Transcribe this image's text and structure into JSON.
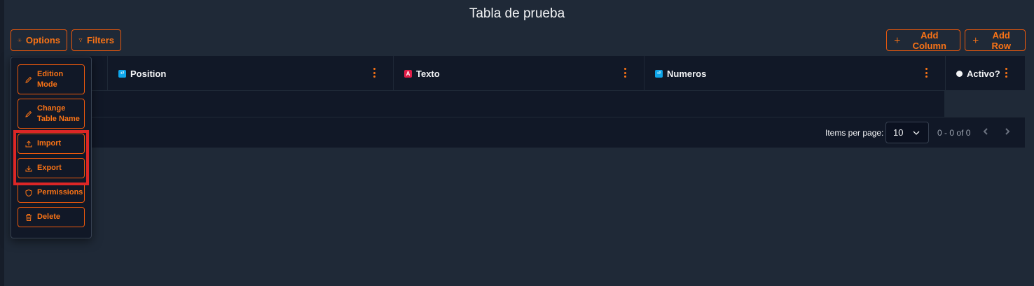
{
  "page": {
    "title": "Tabla de prueba"
  },
  "toolbar": {
    "options_label": "Options",
    "filters_label": "Filters",
    "add_column_label": "Add Column",
    "add_row_label": "Add Row"
  },
  "table": {
    "columns": [
      {
        "label": "Position",
        "type_icon": "number-type-icon"
      },
      {
        "label": "Texto",
        "type_icon": "text-type-icon"
      },
      {
        "label": "Numeros",
        "type_icon": "number-type-icon"
      },
      {
        "label": "Activo?",
        "type_icon": "boolean-type-icon"
      }
    ],
    "rows": []
  },
  "pagination": {
    "items_per_page_label": "Items per page:",
    "items_per_page_value": "10",
    "range_text": "0 - 0 of 0"
  },
  "options_menu": {
    "edition_mode": "Edition Mode",
    "change_table_name": "Change Table Name",
    "import": "Import",
    "export": "Export",
    "permissions": "Permissions",
    "delete": "Delete"
  },
  "colors": {
    "accent": "#f97316",
    "background": "#1f2937",
    "panel": "#111827",
    "highlight": "#dc2626"
  }
}
